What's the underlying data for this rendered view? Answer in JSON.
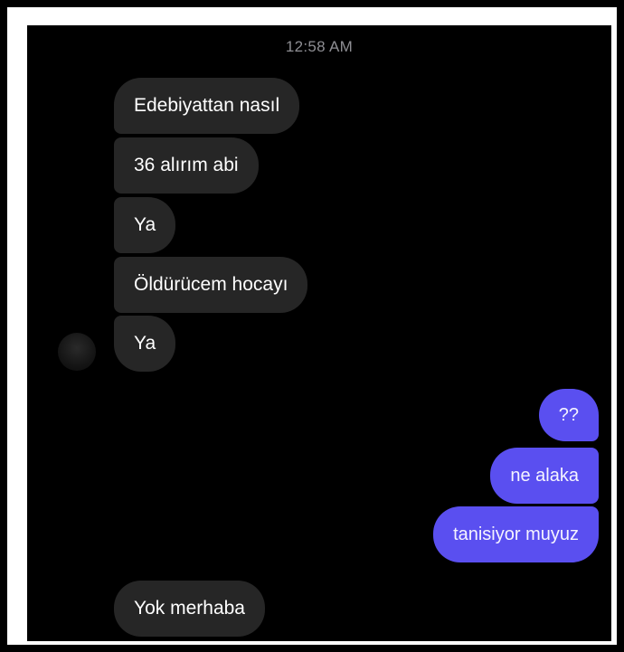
{
  "chat": {
    "timestamp": "12:58 AM",
    "avatar_icon": "user-avatar",
    "colors": {
      "background": "#000000",
      "incoming_bubble": "#262626",
      "outgoing_bubble": "#5a4ff0",
      "text": "#ffffff",
      "timestamp": "#8e8e93"
    },
    "messages": [
      {
        "from": "other",
        "text": "Edebiyattan nasıl"
      },
      {
        "from": "other",
        "text": "36 alırım abi"
      },
      {
        "from": "other",
        "text": "Ya"
      },
      {
        "from": "other",
        "text": "Öldürücem hocayı"
      },
      {
        "from": "other",
        "text": "Ya"
      },
      {
        "from": "me",
        "text": "??"
      },
      {
        "from": "me",
        "text": "ne alaka"
      },
      {
        "from": "me",
        "text": "tanisiyor muyuz"
      },
      {
        "from": "other",
        "text": "Yok merhaba"
      }
    ]
  }
}
